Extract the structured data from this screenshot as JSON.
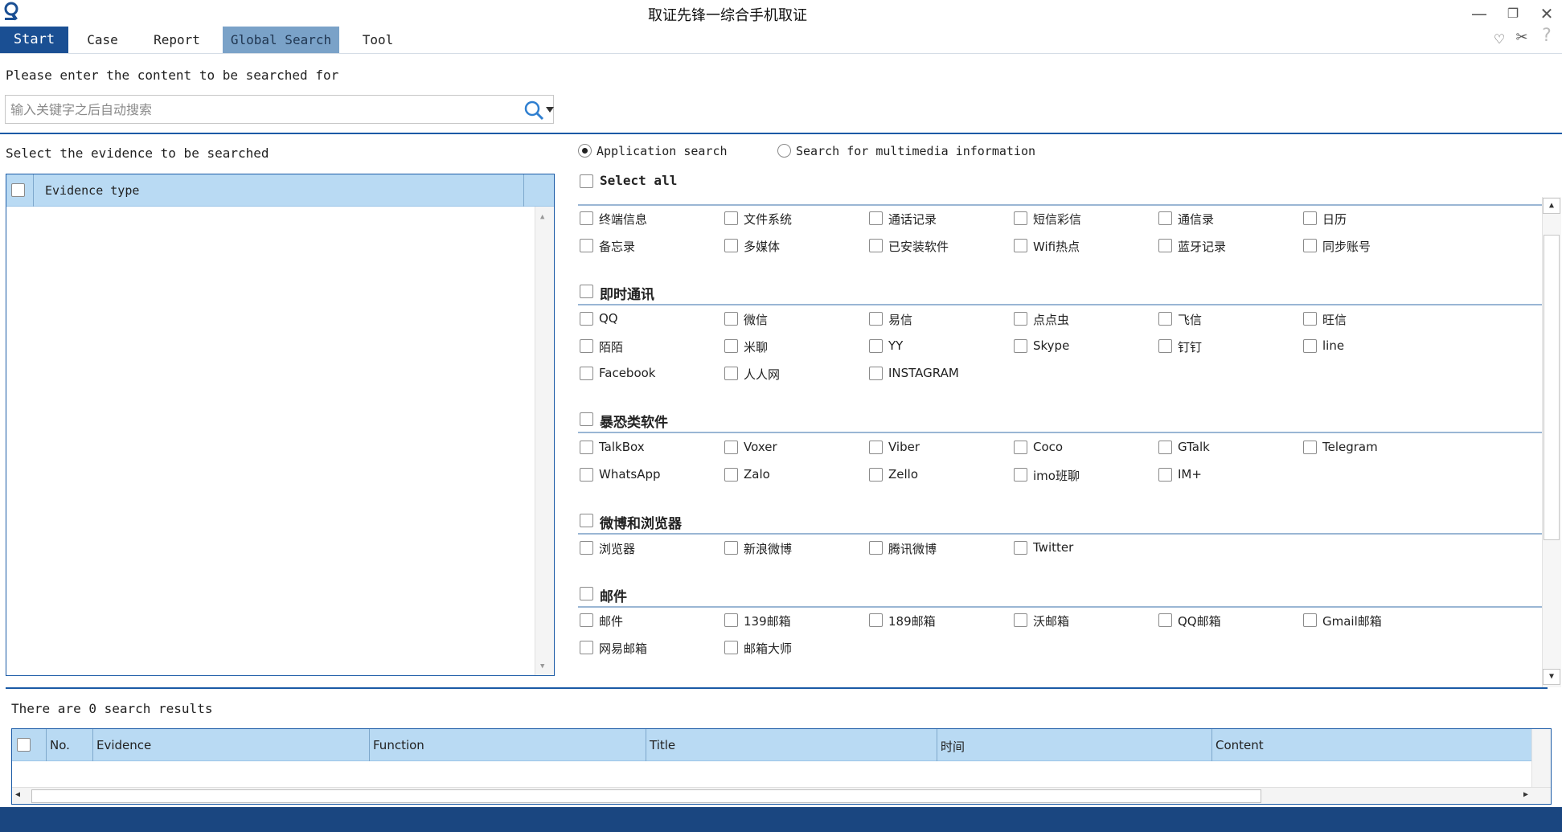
{
  "window": {
    "title": "取证先锋一综合手机取证"
  },
  "menu": {
    "start": "Start",
    "case": "Case",
    "report": "Report",
    "global_search": "Global Search",
    "tool": "Tool"
  },
  "search": {
    "prompt": "Please enter the content to be searched for",
    "placeholder": "输入关键字之后自动搜索",
    "value": ""
  },
  "evidence": {
    "label": "Select the evidence to be searched",
    "column_header": "Evidence type"
  },
  "search_mode": {
    "application": "Application search",
    "multimedia": "Search for multimedia information",
    "selected": "Application search"
  },
  "select_all": "Select all",
  "categories": {
    "basic": {
      "items": [
        "终端信息",
        "文件系统",
        "通话记录",
        "短信彩信",
        "通信录",
        "日历",
        "备忘录",
        "多媒体",
        "已安装软件",
        "Wifi热点",
        "蓝牙记录",
        "同步账号"
      ]
    },
    "im": {
      "title": "即时通讯",
      "items": [
        "QQ",
        "微信",
        "易信",
        "点点虫",
        "飞信",
        "旺信",
        "陌陌",
        "米聊",
        "YY",
        "Skype",
        "钉钉",
        "line",
        "Facebook",
        "人人网",
        "INSTAGRAM"
      ]
    },
    "terror": {
      "title": "暴恐类软件",
      "items": [
        "TalkBox",
        "Voxer",
        "Viber",
        "Coco",
        "GTalk",
        "Telegram",
        "WhatsApp",
        "Zalo",
        "Zello",
        "imo班聊",
        "IM+"
      ]
    },
    "weibo": {
      "title": "微博和浏览器",
      "items": [
        "浏览器",
        "新浪微博",
        "腾讯微博",
        "Twitter"
      ]
    },
    "mail": {
      "title": "邮件",
      "items": [
        "邮件",
        "139邮箱",
        "189邮箱",
        "沃邮箱",
        "QQ邮箱",
        "Gmail邮箱",
        "网易邮箱",
        "邮箱大师"
      ]
    }
  },
  "results": {
    "summary": "There are 0 search results",
    "columns": [
      "No.",
      "Evidence",
      "Function",
      "Title",
      "时间",
      "Content"
    ]
  }
}
